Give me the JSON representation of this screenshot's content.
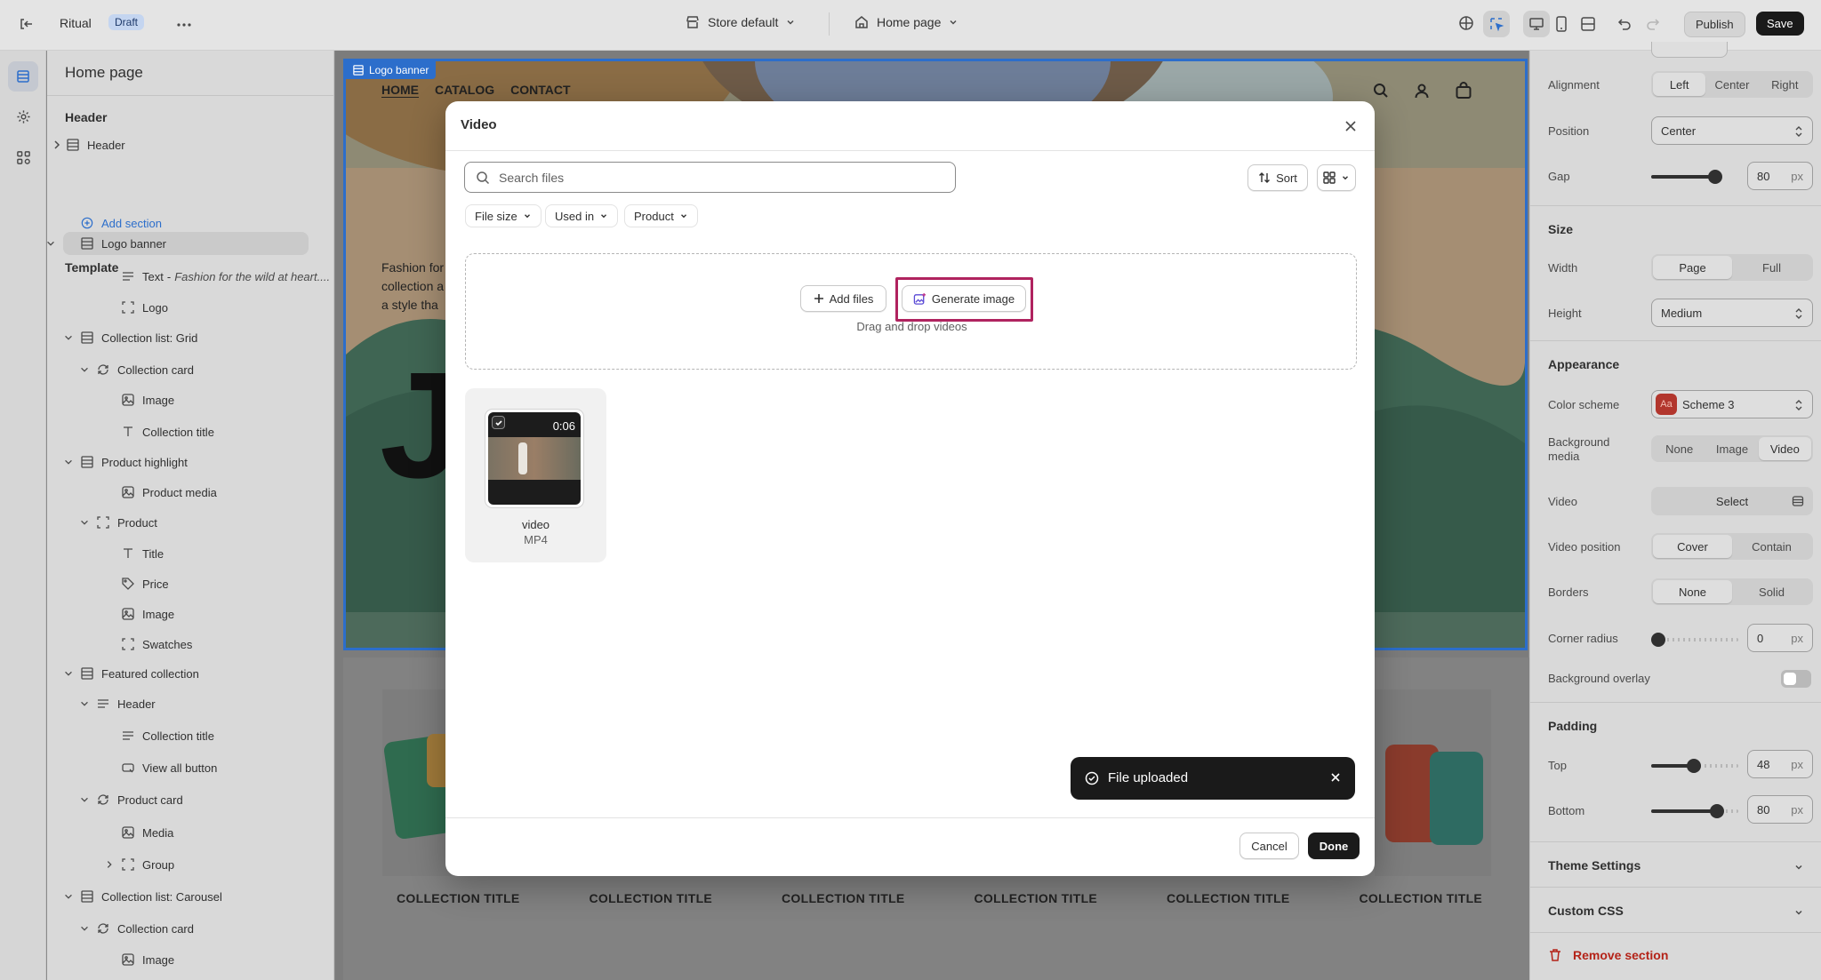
{
  "topbar": {
    "store_name": "Ritual",
    "status_badge": "Draft",
    "theme_selector": "Store default",
    "page_selector": "Home page",
    "publish_label": "Publish",
    "save_label": "Save"
  },
  "sidebar": {
    "page_title": "Home page",
    "header_section_title": "Header",
    "header_item": "Header",
    "add_section": "Add section",
    "template_title": "Template",
    "items": [
      {
        "label": "Logo banner",
        "icon": "section-icon"
      },
      {
        "label": "Text",
        "extra": "Fashion for the wild at heart....",
        "icon": "text-lines-icon"
      },
      {
        "label": "Logo",
        "icon": "frame-icon"
      },
      {
        "label": "Collection list: Grid",
        "icon": "section-icon"
      },
      {
        "label": "Collection card",
        "icon": "repeat-icon"
      },
      {
        "label": "Image",
        "icon": "image-icon"
      },
      {
        "label": "Collection title",
        "icon": "type-icon"
      },
      {
        "label": "Product highlight",
        "icon": "section-icon"
      },
      {
        "label": "Product media",
        "icon": "image-icon"
      },
      {
        "label": "Product",
        "icon": "frame-icon"
      },
      {
        "label": "Title",
        "icon": "type-icon"
      },
      {
        "label": "Price",
        "icon": "price-tag-icon"
      },
      {
        "label": "Image",
        "icon": "image-icon"
      },
      {
        "label": "Swatches",
        "icon": "frame-icon"
      },
      {
        "label": "Featured collection",
        "icon": "section-icon"
      },
      {
        "label": "Header",
        "icon": "text-lines-icon"
      },
      {
        "label": "Collection title",
        "icon": "text-lines-icon"
      },
      {
        "label": "View all button",
        "icon": "button-icon"
      },
      {
        "label": "Product card",
        "icon": "repeat-icon"
      },
      {
        "label": "Media",
        "icon": "image-icon"
      },
      {
        "label": "Group",
        "icon": "frame-icon"
      },
      {
        "label": "Collection list: Carousel",
        "icon": "section-icon"
      },
      {
        "label": "Collection card",
        "icon": "repeat-icon"
      },
      {
        "label": "Image",
        "icon": "image-icon"
      }
    ]
  },
  "preview": {
    "selection_tag": "Logo banner",
    "nav": [
      "HOME",
      "CATALOG",
      "CONTACT"
    ],
    "text_lines": [
      "Fashion for",
      "collection a",
      "a style tha"
    ],
    "big_letter": "J",
    "collection_titles": [
      "COLLECTION TITLE",
      "COLLECTION TITLE",
      "COLLECTION TITLE",
      "COLLECTION TITLE",
      "COLLECTION TITLE",
      "COLLECTION TITLE"
    ]
  },
  "modal": {
    "title": "Video",
    "search_placeholder": "Search files",
    "sort_label": "Sort",
    "filters": [
      "File size",
      "Used in",
      "Product"
    ],
    "add_files_label": "Add files",
    "generate_image_label": "Generate image",
    "drop_hint": "Drag and drop videos",
    "file": {
      "name": "video",
      "type": "MP4",
      "duration": "0:06"
    },
    "cancel_label": "Cancel",
    "done_label": "Done"
  },
  "toast": {
    "message": "File uploaded"
  },
  "right_panel": {
    "alignment_label": "Alignment",
    "alignment_options": [
      "Left",
      "Center",
      "Right"
    ],
    "position_label": "Position",
    "position_value": "Center",
    "gap_label": "Gap",
    "gap_value": "80",
    "unit": "px",
    "size_title": "Size",
    "width_label": "Width",
    "width_options": [
      "Page",
      "Full"
    ],
    "height_label": "Height",
    "height_value": "Medium",
    "appearance_title": "Appearance",
    "color_scheme_label": "Color scheme",
    "color_scheme_value": "Scheme 3",
    "color_scheme_swatch": "Aa",
    "background_media_label": "Background media",
    "background_media_options": [
      "None",
      "Image",
      "Video"
    ],
    "video_label": "Video",
    "video_select": "Select",
    "video_position_label": "Video position",
    "video_position_options": [
      "Cover",
      "Contain"
    ],
    "borders_label": "Borders",
    "borders_options": [
      "None",
      "Solid"
    ],
    "corner_radius_label": "Corner radius",
    "corner_radius_value": "0",
    "background_overlay_label": "Background overlay",
    "padding_title": "Padding",
    "top_label": "Top",
    "top_value": "48",
    "bottom_label": "Bottom",
    "bottom_value": "80",
    "theme_settings": "Theme Settings",
    "custom_css": "Custom CSS",
    "remove_section": "Remove section"
  },
  "colors": {
    "accent_blue": "#2c6ecb",
    "highlight_magenta": "#b0235f",
    "danger_red": "#b42318",
    "dark_button": "#1a1a1a"
  }
}
